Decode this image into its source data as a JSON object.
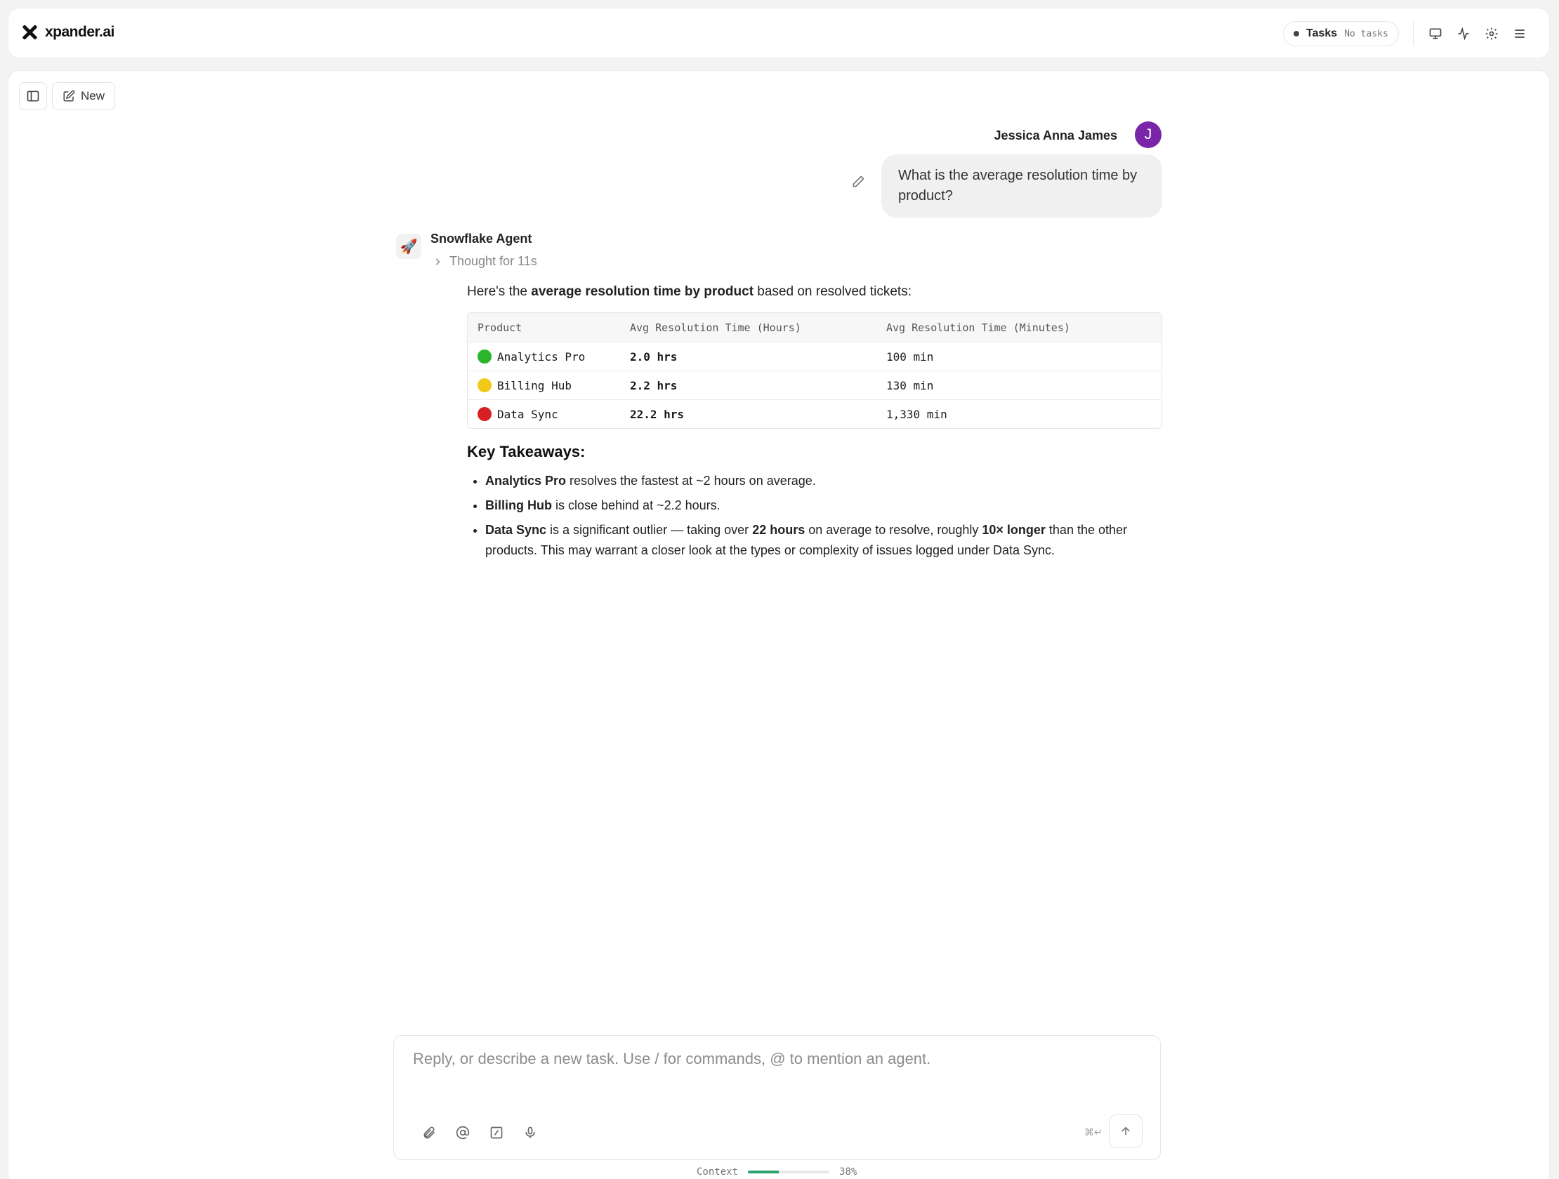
{
  "app": {
    "name": "xpander.ai"
  },
  "topbar": {
    "tasks_label": "Tasks",
    "tasks_status": "No tasks",
    "icons": [
      "monitor-icon",
      "activity-icon",
      "gear-icon",
      "menu-icon"
    ]
  },
  "toolbar": {
    "new_label": "New"
  },
  "user_message": {
    "author": "Jessica Anna James",
    "avatar_initial": "J",
    "avatar_color": "#7a24a8",
    "text": "What is the average resolution time by product?"
  },
  "agent": {
    "name": "Snowflake Agent",
    "thought": "Thought for 11s",
    "intro_prefix": "Here's the ",
    "intro_bold": "average resolution time by product",
    "intro_suffix": " based on resolved tickets:",
    "table": {
      "headers": [
        "Product",
        "Avg Resolution Time (Hours)",
        "Avg Resolution Time (Minutes)"
      ],
      "rows": [
        {
          "status_color": "#2bb52b",
          "product": "Analytics Pro",
          "hours": "2.0 hrs",
          "minutes": "100 min"
        },
        {
          "status_color": "#f2c81b",
          "product": "Billing Hub",
          "hours": "2.2 hrs",
          "minutes": "130 min"
        },
        {
          "status_color": "#d81f26",
          "product": "Data Sync",
          "hours": "22.2 hrs",
          "minutes": "1,330 min"
        }
      ]
    },
    "takeaways_heading": "Key Takeaways:",
    "takeaways": [
      {
        "bold": "Analytics Pro",
        "text": " resolves the fastest at ~2 hours on average."
      },
      {
        "bold": "Billing Hub",
        "text": " is close behind at ~2.2 hours."
      },
      {
        "bold": "Data Sync",
        "text_1": " is a significant outlier — taking over ",
        "bold_2": "22 hours",
        "text_2": " on average to resolve, roughly ",
        "bold_3": "10× longer",
        "text_3": " than the other products. This may warrant a closer look at the types or complexity of issues logged under Data Sync."
      }
    ]
  },
  "composer": {
    "placeholder": "Reply, or describe a new task. Use / for commands, @ to mention an agent.",
    "shortcut": "⌘↵"
  },
  "context": {
    "label": "Context",
    "percent_text": "38%",
    "fill_fraction": 0.38,
    "accent": "#2aa06a"
  }
}
